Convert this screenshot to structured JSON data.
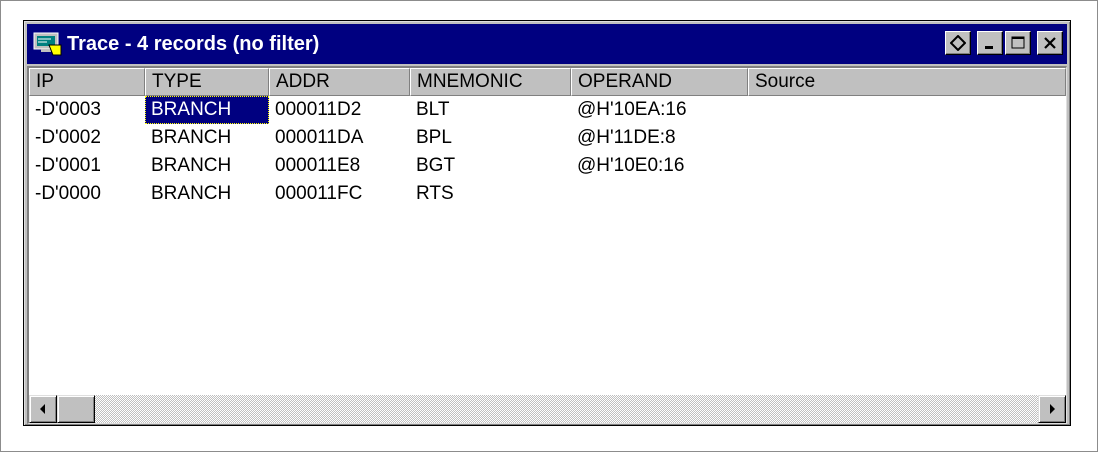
{
  "window": {
    "title": "Trace - 4 records (no filter)",
    "icons": {
      "app": "trace-window-icon",
      "restore": "diamond-icon",
      "minimize": "minimize-icon",
      "maximize": "maximize-icon",
      "close": "close-icon"
    }
  },
  "table": {
    "columns": [
      "IP",
      "TYPE",
      "ADDR",
      "MNEMONIC",
      "OPERAND",
      "Source"
    ],
    "rows": [
      [
        "-D'0003",
        "BRANCH",
        "000011D2",
        "BLT",
        "@H'10EA:16",
        ""
      ],
      [
        "-D'0002",
        "BRANCH",
        "000011DA",
        "BPL",
        "@H'11DE:8",
        ""
      ],
      [
        "-D'0001",
        "BRANCH",
        "000011E8",
        "BGT",
        "@H'10E0:16",
        ""
      ],
      [
        "-D'0000",
        "BRANCH",
        "000011FC",
        "RTS",
        "",
        ""
      ]
    ],
    "selected_row": 0,
    "selected_column": 1
  },
  "scrollbar": {
    "left_arrow": "scroll-left-arrow-icon",
    "right_arrow": "scroll-right-arrow-icon"
  },
  "colors": {
    "titlebar": "#000080",
    "selection": "#000080",
    "face": "#c0c0c0"
  }
}
